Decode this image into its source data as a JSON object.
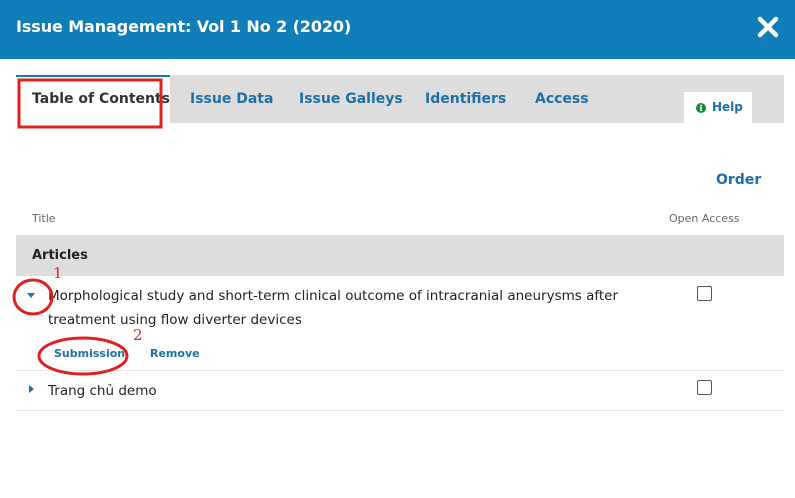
{
  "modal": {
    "title": "Issue Management: Vol 1 No 2 (2020)",
    "close_icon": "close-icon"
  },
  "tabs": [
    {
      "label": "Table of Contents",
      "active": true
    },
    {
      "label": "Issue Data",
      "active": false
    },
    {
      "label": "Issue Galleys",
      "active": false
    },
    {
      "label": "Identifiers",
      "active": false
    },
    {
      "label": "Access",
      "active": false
    }
  ],
  "help": {
    "label": "Help",
    "icon": "info-icon"
  },
  "toolbar": {
    "order_label": "Order"
  },
  "table": {
    "columns": {
      "title": "Title",
      "open_access": "Open Access"
    },
    "section": "Articles",
    "rows": [
      {
        "title": "Morphological study and short-term clinical outcome of intracranial aneurysms after treatment using flow diverter devices",
        "expanded": true,
        "open_access": false,
        "actions": [
          "Submission",
          "Remove"
        ]
      },
      {
        "title": "Trang chủ demo",
        "expanded": false,
        "open_access": false
      }
    ]
  },
  "annotations": {
    "marker_1": "1",
    "marker_2": "2"
  },
  "colors": {
    "header": "#0f7eb8",
    "link": "#1e6fa6",
    "tab_bar": "#dddddd",
    "annotation": "#e02020"
  }
}
